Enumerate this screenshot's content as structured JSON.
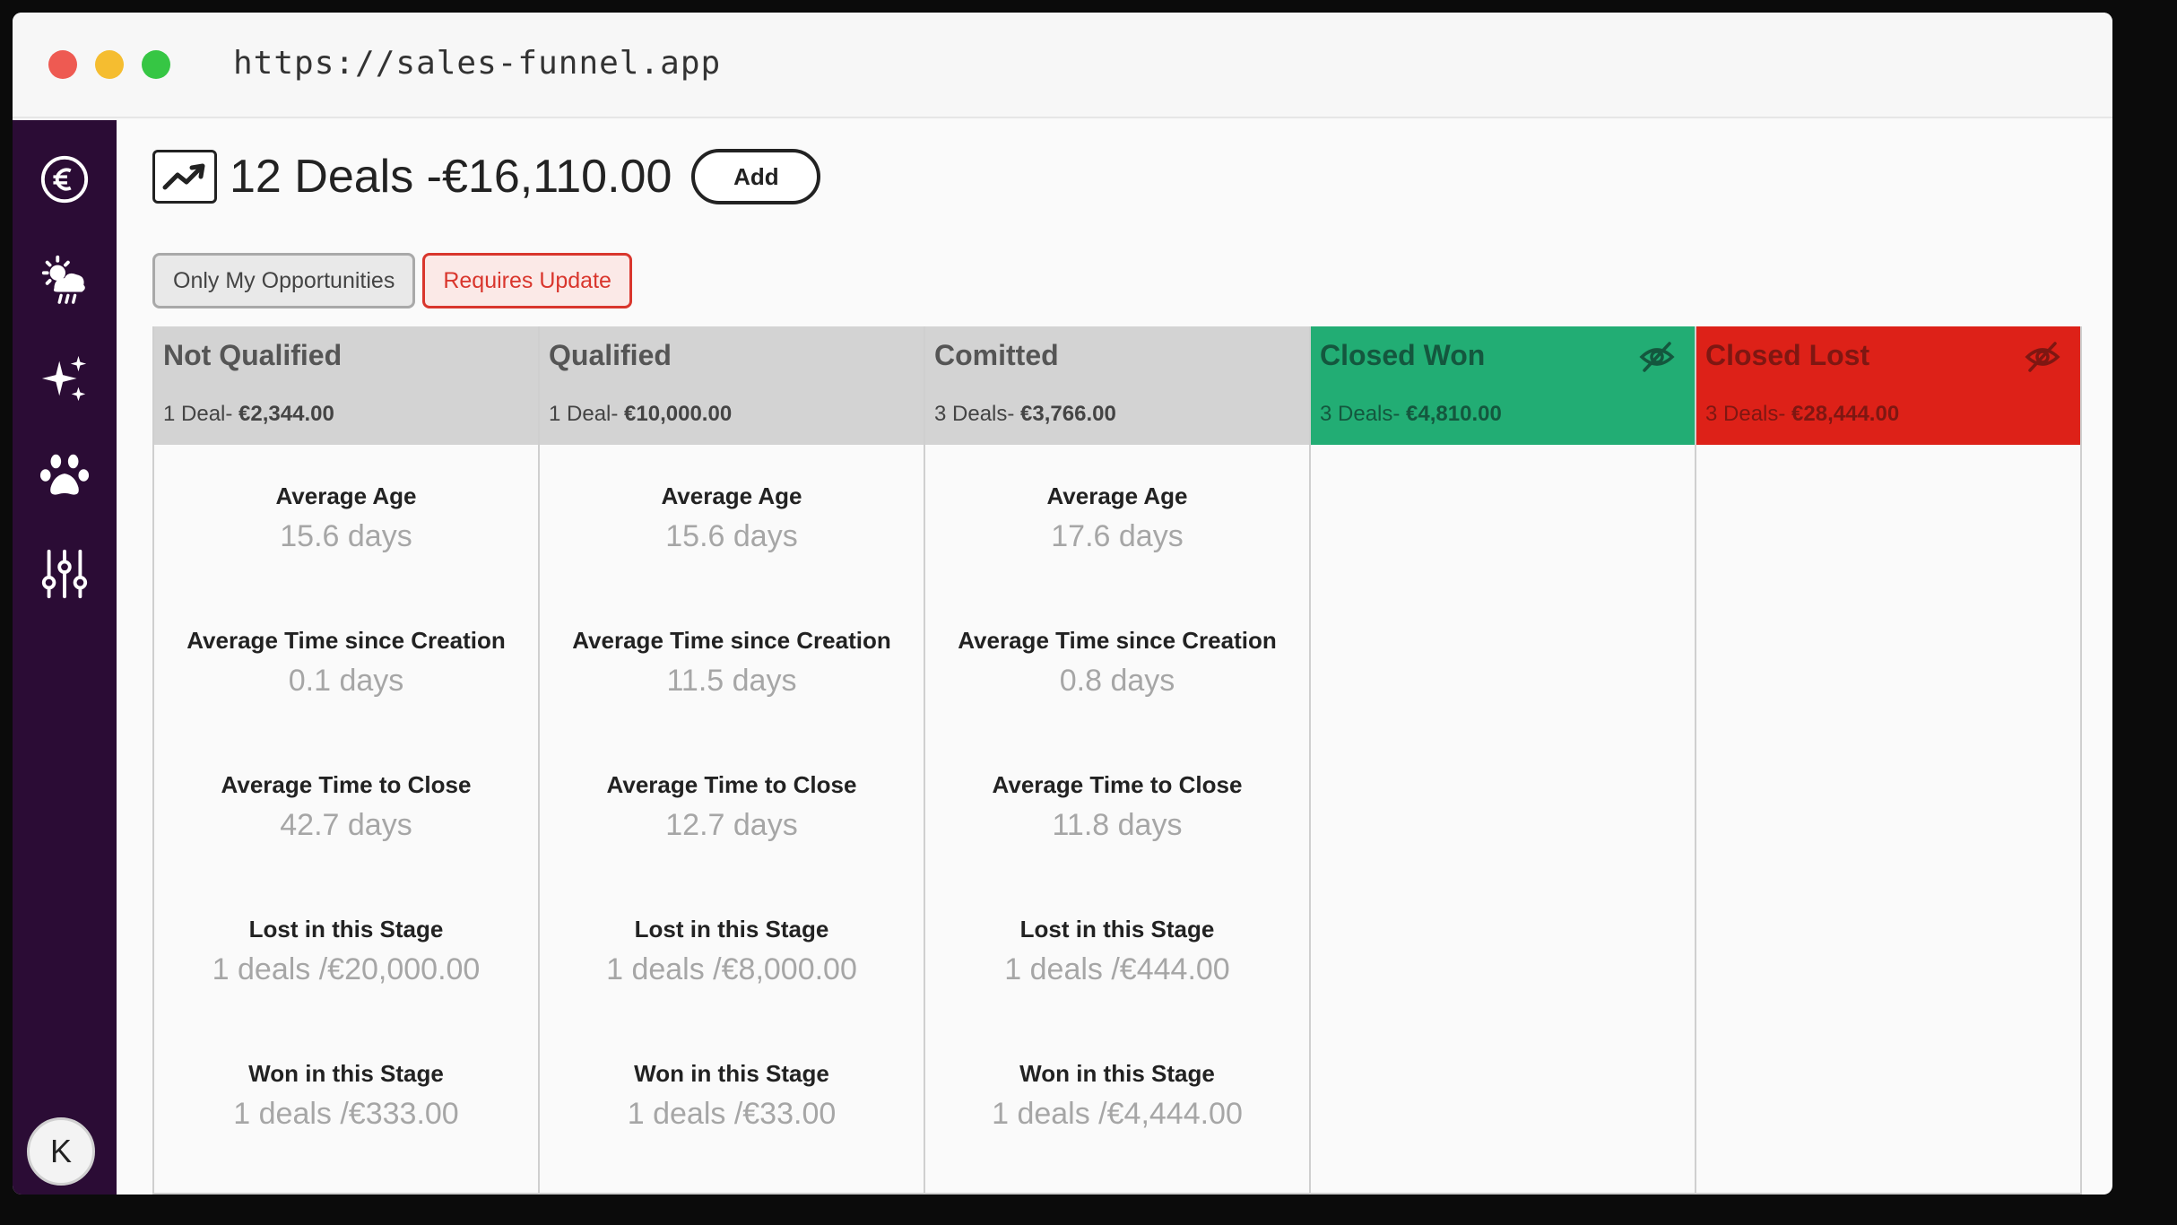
{
  "browser": {
    "url": "https://sales-funnel.app"
  },
  "sidebar": {
    "items": [
      {
        "icon": "euro-icon"
      },
      {
        "icon": "weather-icon"
      },
      {
        "icon": "sparkles-icon"
      },
      {
        "icon": "paw-icon"
      },
      {
        "icon": "sliders-icon"
      }
    ],
    "avatar_initial": "K"
  },
  "header": {
    "icon": "trending-up-icon",
    "title": "12 Deals -€16,110.00",
    "add_label": "Add"
  },
  "filters": {
    "only_mine": "Only My Opportunities",
    "requires_update": "Requires Update"
  },
  "colors": {
    "sidebar": "#2b0c35",
    "won": "#22ad74",
    "lost": "#dd2118",
    "requires_update": "#d9362d"
  },
  "columns": [
    {
      "name": "Not Qualified",
      "count": "1 Deal-",
      "amount": "€2,344.00",
      "stats": [
        {
          "label": "Average Age",
          "value": "15.6 days"
        },
        {
          "label": "Average Time since Creation",
          "value": "0.1 days"
        },
        {
          "label": "Average Time to Close",
          "value": "42.7 days"
        },
        {
          "label": "Lost in this Stage",
          "value": "1 deals /€20,000.00"
        },
        {
          "label": "Won in this Stage",
          "value": "1 deals /€333.00"
        }
      ]
    },
    {
      "name": "Qualified",
      "count": "1 Deal-",
      "amount": "€10,000.00",
      "stats": [
        {
          "label": "Average Age",
          "value": "15.6 days"
        },
        {
          "label": "Average Time since Creation",
          "value": "11.5 days"
        },
        {
          "label": "Average Time to Close",
          "value": "12.7 days"
        },
        {
          "label": "Lost in this Stage",
          "value": "1 deals /€8,000.00"
        },
        {
          "label": "Won in this Stage",
          "value": "1 deals /€33.00"
        }
      ]
    },
    {
      "name": "Comitted",
      "count": "3 Deals-",
      "amount": "€3,766.00",
      "stats": [
        {
          "label": "Average Age",
          "value": "17.6 days"
        },
        {
          "label": "Average Time since Creation",
          "value": "0.8 days"
        },
        {
          "label": "Average Time to Close",
          "value": "11.8 days"
        },
        {
          "label": "Lost in this Stage",
          "value": "1 deals /€444.00"
        },
        {
          "label": "Won in this Stage",
          "value": "1 deals /€4,444.00"
        }
      ]
    },
    {
      "name": "Closed Won",
      "count": "3 Deals-",
      "amount": "€4,810.00",
      "hidden_icon": "eye-off-icon"
    },
    {
      "name": "Closed Lost",
      "count": "3 Deals-",
      "amount": "€28,444.00",
      "hidden_icon": "eye-off-icon"
    }
  ]
}
